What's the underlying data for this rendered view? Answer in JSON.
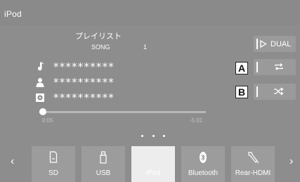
{
  "header": {
    "title": "iPod"
  },
  "now_playing": {
    "playlist_label": "プレイリスト",
    "song_label": "SONG",
    "song_number": "1",
    "title_masked": "**********",
    "artist_masked": "**********",
    "album_masked": "**********",
    "elapsed": "0:05",
    "remaining": "-5:01",
    "progress": 0.02
  },
  "controls": {
    "dual_label": "DUAL",
    "repeat_icon": "repeat-icon",
    "shuffle_icon": "shuffle-icon"
  },
  "callouts": {
    "a": "A",
    "b": "B"
  },
  "sources": [
    {
      "label": "SD",
      "icon": "sd-card-icon",
      "active": false
    },
    {
      "label": "USB",
      "icon": "usb-icon",
      "active": false
    },
    {
      "label": "iPod",
      "icon": "ipod-icon",
      "active": true
    },
    {
      "label": "Bluetooth",
      "icon": "bluetooth-icon",
      "active": false
    },
    {
      "label": "Rear-HDMI",
      "icon": "hdmi-icon",
      "active": false
    }
  ],
  "nav": {
    "prev": "‹",
    "next": "›"
  }
}
